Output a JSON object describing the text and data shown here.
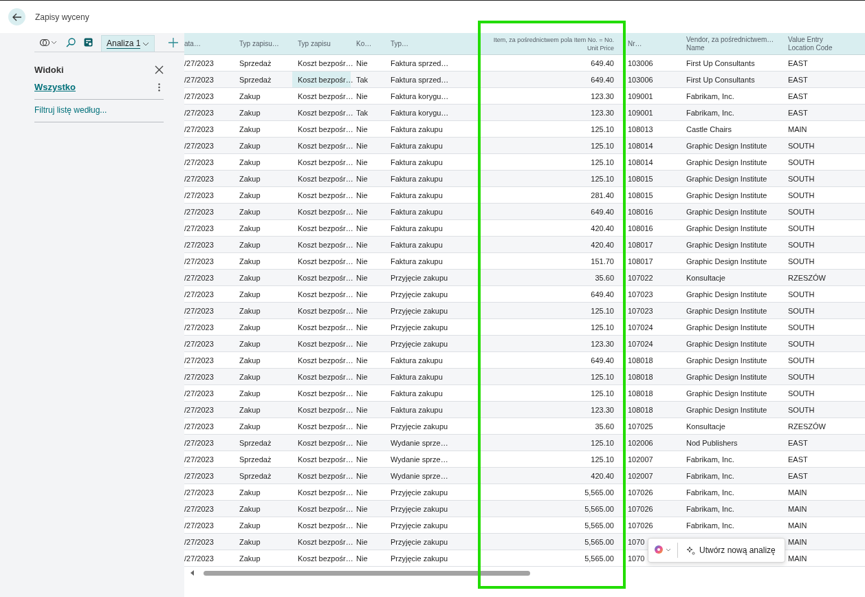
{
  "page": {
    "title": "Zapisy wyceny"
  },
  "toolbar": {
    "tabs": [
      {
        "label": "Analiza 1",
        "selected": true
      }
    ]
  },
  "views_panel": {
    "title": "Widoki",
    "items": [
      {
        "label": "Wszystko",
        "selected": true
      }
    ],
    "filter_link": "Filtruj listę według..."
  },
  "table": {
    "columns": [
      {
        "label": "ata…",
        "kind": "text",
        "highlighted": false
      },
      {
        "label": "Typ zapisu…",
        "kind": "text",
        "highlighted": false
      },
      {
        "label": "Typ zapisu",
        "kind": "text",
        "highlighted": false
      },
      {
        "label": "Ko…",
        "kind": "text",
        "highlighted": false
      },
      {
        "label": "Typ…",
        "kind": "text",
        "highlighted": false
      },
      {
        "label": "Item, za pośrednictwem pola Item No. = No.\nUnit Price",
        "kind": "number",
        "highlighted": true
      },
      {
        "label": "Nr…",
        "kind": "text",
        "highlighted": false
      },
      {
        "label": "Vendor, za pośrednictwem…\nName",
        "kind": "text",
        "highlighted": false
      },
      {
        "label": "Value Entry\nLocation Code",
        "kind": "text",
        "highlighted": false
      }
    ],
    "rows": [
      {
        "selected": false,
        "cells": [
          "/27/2023",
          "Sprzedaż",
          "Koszt bezpośr…",
          "Nie",
          "Faktura sprzed…",
          "649.40",
          "103006",
          "First Up Consultants",
          "EAST"
        ]
      },
      {
        "selected": true,
        "cells": [
          "/27/2023",
          "Sprzedaż",
          "Koszt bezpośr…",
          "Tak",
          "Faktura sprzed…",
          "649.40",
          "103006",
          "First Up Consultants",
          "EAST"
        ]
      },
      {
        "selected": false,
        "cells": [
          "/27/2023",
          "Zakup",
          "Koszt bezpośr…",
          "Nie",
          "Faktura korygu…",
          "123.30",
          "109001",
          "Fabrikam, Inc.",
          "EAST"
        ]
      },
      {
        "selected": false,
        "cells": [
          "/27/2023",
          "Zakup",
          "Koszt bezpośr…",
          "Tak",
          "Faktura korygu…",
          "123.30",
          "109001",
          "Fabrikam, Inc.",
          "EAST"
        ]
      },
      {
        "selected": false,
        "cells": [
          "/27/2023",
          "Zakup",
          "Koszt bezpośr…",
          "Nie",
          "Faktura zakupu",
          "125.10",
          "108013",
          "Castle Chairs",
          "MAIN"
        ]
      },
      {
        "selected": false,
        "cells": [
          "/27/2023",
          "Zakup",
          "Koszt bezpośr…",
          "Nie",
          "Faktura zakupu",
          "125.10",
          "108014",
          "Graphic Design Institute",
          "SOUTH"
        ]
      },
      {
        "selected": false,
        "cells": [
          "/27/2023",
          "Zakup",
          "Koszt bezpośr…",
          "Nie",
          "Faktura zakupu",
          "125.10",
          "108014",
          "Graphic Design Institute",
          "SOUTH"
        ]
      },
      {
        "selected": false,
        "cells": [
          "/27/2023",
          "Zakup",
          "Koszt bezpośr…",
          "Nie",
          "Faktura zakupu",
          "125.10",
          "108015",
          "Graphic Design Institute",
          "SOUTH"
        ]
      },
      {
        "selected": false,
        "cells": [
          "/27/2023",
          "Zakup",
          "Koszt bezpośr…",
          "Nie",
          "Faktura zakupu",
          "281.40",
          "108015",
          "Graphic Design Institute",
          "SOUTH"
        ]
      },
      {
        "selected": false,
        "cells": [
          "/27/2023",
          "Zakup",
          "Koszt bezpośr…",
          "Nie",
          "Faktura zakupu",
          "649.40",
          "108016",
          "Graphic Design Institute",
          "SOUTH"
        ]
      },
      {
        "selected": false,
        "cells": [
          "/27/2023",
          "Zakup",
          "Koszt bezpośr…",
          "Nie",
          "Faktura zakupu",
          "420.40",
          "108016",
          "Graphic Design Institute",
          "SOUTH"
        ]
      },
      {
        "selected": false,
        "cells": [
          "/27/2023",
          "Zakup",
          "Koszt bezpośr…",
          "Nie",
          "Faktura zakupu",
          "420.40",
          "108017",
          "Graphic Design Institute",
          "SOUTH"
        ]
      },
      {
        "selected": false,
        "cells": [
          "/27/2023",
          "Zakup",
          "Koszt bezpośr…",
          "Nie",
          "Faktura zakupu",
          "151.70",
          "108017",
          "Graphic Design Institute",
          "SOUTH"
        ]
      },
      {
        "selected": false,
        "cells": [
          "/27/2023",
          "Zakup",
          "Koszt bezpośr…",
          "Nie",
          "Przyjęcie zakupu",
          "35.60",
          "107022",
          "Konsultacje",
          "RZESZÓW"
        ]
      },
      {
        "selected": false,
        "cells": [
          "/27/2023",
          "Zakup",
          "Koszt bezpośr…",
          "Nie",
          "Przyjęcie zakupu",
          "649.40",
          "107023",
          "Graphic Design Institute",
          "SOUTH"
        ]
      },
      {
        "selected": false,
        "cells": [
          "/27/2023",
          "Zakup",
          "Koszt bezpośr…",
          "Nie",
          "Przyjęcie zakupu",
          "125.10",
          "107023",
          "Graphic Design Institute",
          "SOUTH"
        ]
      },
      {
        "selected": false,
        "cells": [
          "/27/2023",
          "Zakup",
          "Koszt bezpośr…",
          "Nie",
          "Przyjęcie zakupu",
          "125.10",
          "107024",
          "Graphic Design Institute",
          "SOUTH"
        ]
      },
      {
        "selected": false,
        "cells": [
          "/27/2023",
          "Zakup",
          "Koszt bezpośr…",
          "Nie",
          "Przyjęcie zakupu",
          "123.30",
          "107024",
          "Graphic Design Institute",
          "SOUTH"
        ]
      },
      {
        "selected": false,
        "cells": [
          "/27/2023",
          "Zakup",
          "Koszt bezpośr…",
          "Nie",
          "Faktura zakupu",
          "649.40",
          "108018",
          "Graphic Design Institute",
          "SOUTH"
        ]
      },
      {
        "selected": false,
        "cells": [
          "/27/2023",
          "Zakup",
          "Koszt bezpośr…",
          "Nie",
          "Faktura zakupu",
          "125.10",
          "108018",
          "Graphic Design Institute",
          "SOUTH"
        ]
      },
      {
        "selected": false,
        "cells": [
          "/27/2023",
          "Zakup",
          "Koszt bezpośr…",
          "Nie",
          "Faktura zakupu",
          "125.10",
          "108018",
          "Graphic Design Institute",
          "SOUTH"
        ]
      },
      {
        "selected": false,
        "cells": [
          "/27/2023",
          "Zakup",
          "Koszt bezpośr…",
          "Nie",
          "Faktura zakupu",
          "123.30",
          "108018",
          "Graphic Design Institute",
          "SOUTH"
        ]
      },
      {
        "selected": false,
        "cells": [
          "/27/2023",
          "Zakup",
          "Koszt bezpośr…",
          "Nie",
          "Przyjęcie zakupu",
          "35.60",
          "107025",
          "Konsultacje",
          "RZESZÓW"
        ]
      },
      {
        "selected": false,
        "cells": [
          "/27/2023",
          "Sprzedaż",
          "Koszt bezpośr…",
          "Nie",
          "Wydanie sprze…",
          "125.10",
          "102006",
          "Nod Publishers",
          "EAST"
        ]
      },
      {
        "selected": false,
        "cells": [
          "/27/2023",
          "Sprzedaż",
          "Koszt bezpośr…",
          "Nie",
          "Wydanie sprze…",
          "125.10",
          "102007",
          "Fabrikam, Inc.",
          "EAST"
        ]
      },
      {
        "selected": false,
        "cells": [
          "/27/2023",
          "Sprzedaż",
          "Koszt bezpośr…",
          "Nie",
          "Wydanie sprze…",
          "420.40",
          "102007",
          "Fabrikam, Inc.",
          "EAST"
        ]
      },
      {
        "selected": false,
        "cells": [
          "/27/2023",
          "Zakup",
          "Koszt bezpośr…",
          "Nie",
          "Przyjęcie zakupu",
          "5,565.00",
          "107026",
          "Fabrikam, Inc.",
          "MAIN"
        ]
      },
      {
        "selected": false,
        "cells": [
          "/27/2023",
          "Zakup",
          "Koszt bezpośr…",
          "Nie",
          "Przyjęcie zakupu",
          "5,565.00",
          "107026",
          "Fabrikam, Inc.",
          "MAIN"
        ]
      },
      {
        "selected": false,
        "cells": [
          "/27/2023",
          "Zakup",
          "Koszt bezpośr…",
          "Nie",
          "Przyjęcie zakupu",
          "5,565.00",
          "107026",
          "Fabrikam, Inc.",
          "MAIN"
        ]
      },
      {
        "selected": false,
        "cells": [
          "/27/2023",
          "Zakup",
          "Koszt bezpośr…",
          "Nie",
          "Przyjęcie zakupu",
          "5,565.00",
          "1070",
          null,
          "MAIN"
        ]
      },
      {
        "selected": false,
        "cells": [
          "/27/2023",
          "Zakup",
          "Koszt bezpośr…",
          "Nie",
          "Przyjęcie zakupu",
          "5,565.00",
          "1070",
          null,
          "MAIN"
        ]
      }
    ]
  },
  "analysis_popup": {
    "button": "Utwórz nową analizę"
  }
}
